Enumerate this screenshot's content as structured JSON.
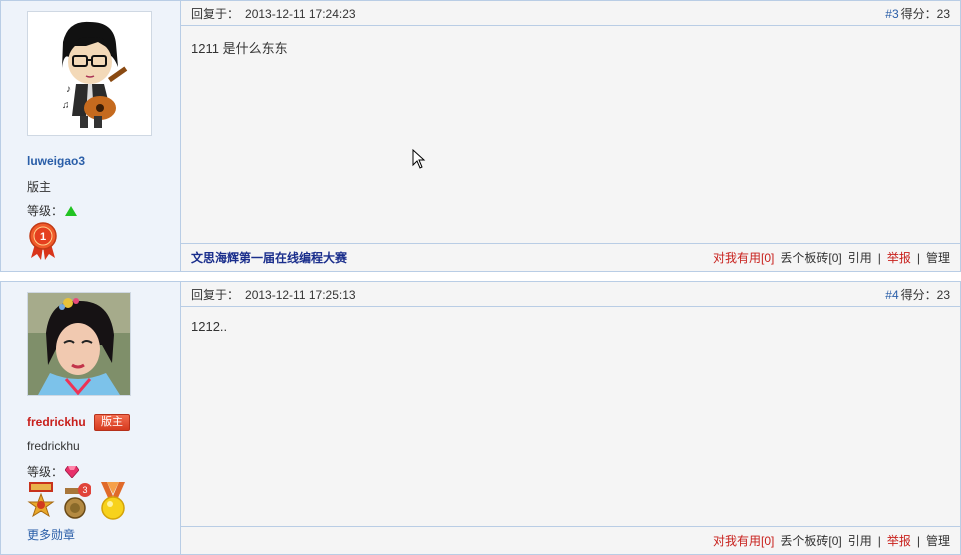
{
  "posts": [
    {
      "username": "luweigao3",
      "role": "版主",
      "level_label": "等级：",
      "reply_label": "回复于：",
      "timestamp": "2013-12-11 17:24:23",
      "floor": "#3",
      "score_label": "得分：",
      "score": "23",
      "content": "1211 是什么东东",
      "promo": "文思海辉第一届在线编程大赛",
      "actions": {
        "useful": "对我有用[0]",
        "brick": "丢个板砖[0]",
        "quote": "引用",
        "report": "举报",
        "manage": "管理"
      },
      "medal_rank": "1"
    },
    {
      "username": "fredrickhu",
      "mod_badge": "版主",
      "role": "fredrickhu",
      "level_label": "等级：",
      "reply_label": "回复于：",
      "timestamp": "2013-12-11 17:25:13",
      "floor": "#4",
      "score_label": "得分：",
      "score": "23",
      "content": "1212..",
      "more_medals": "更多勋章",
      "medal_count": "3",
      "actions": {
        "useful": "对我有用[0]",
        "brick": "丢个板砖[0]",
        "quote": "引用",
        "report": "举报",
        "manage": "管理"
      }
    }
  ],
  "colors": {
    "border": "#b9cde5",
    "sidebar": "#eef3fa",
    "link_blue": "#2a5ea8",
    "red": "#c8201c"
  }
}
